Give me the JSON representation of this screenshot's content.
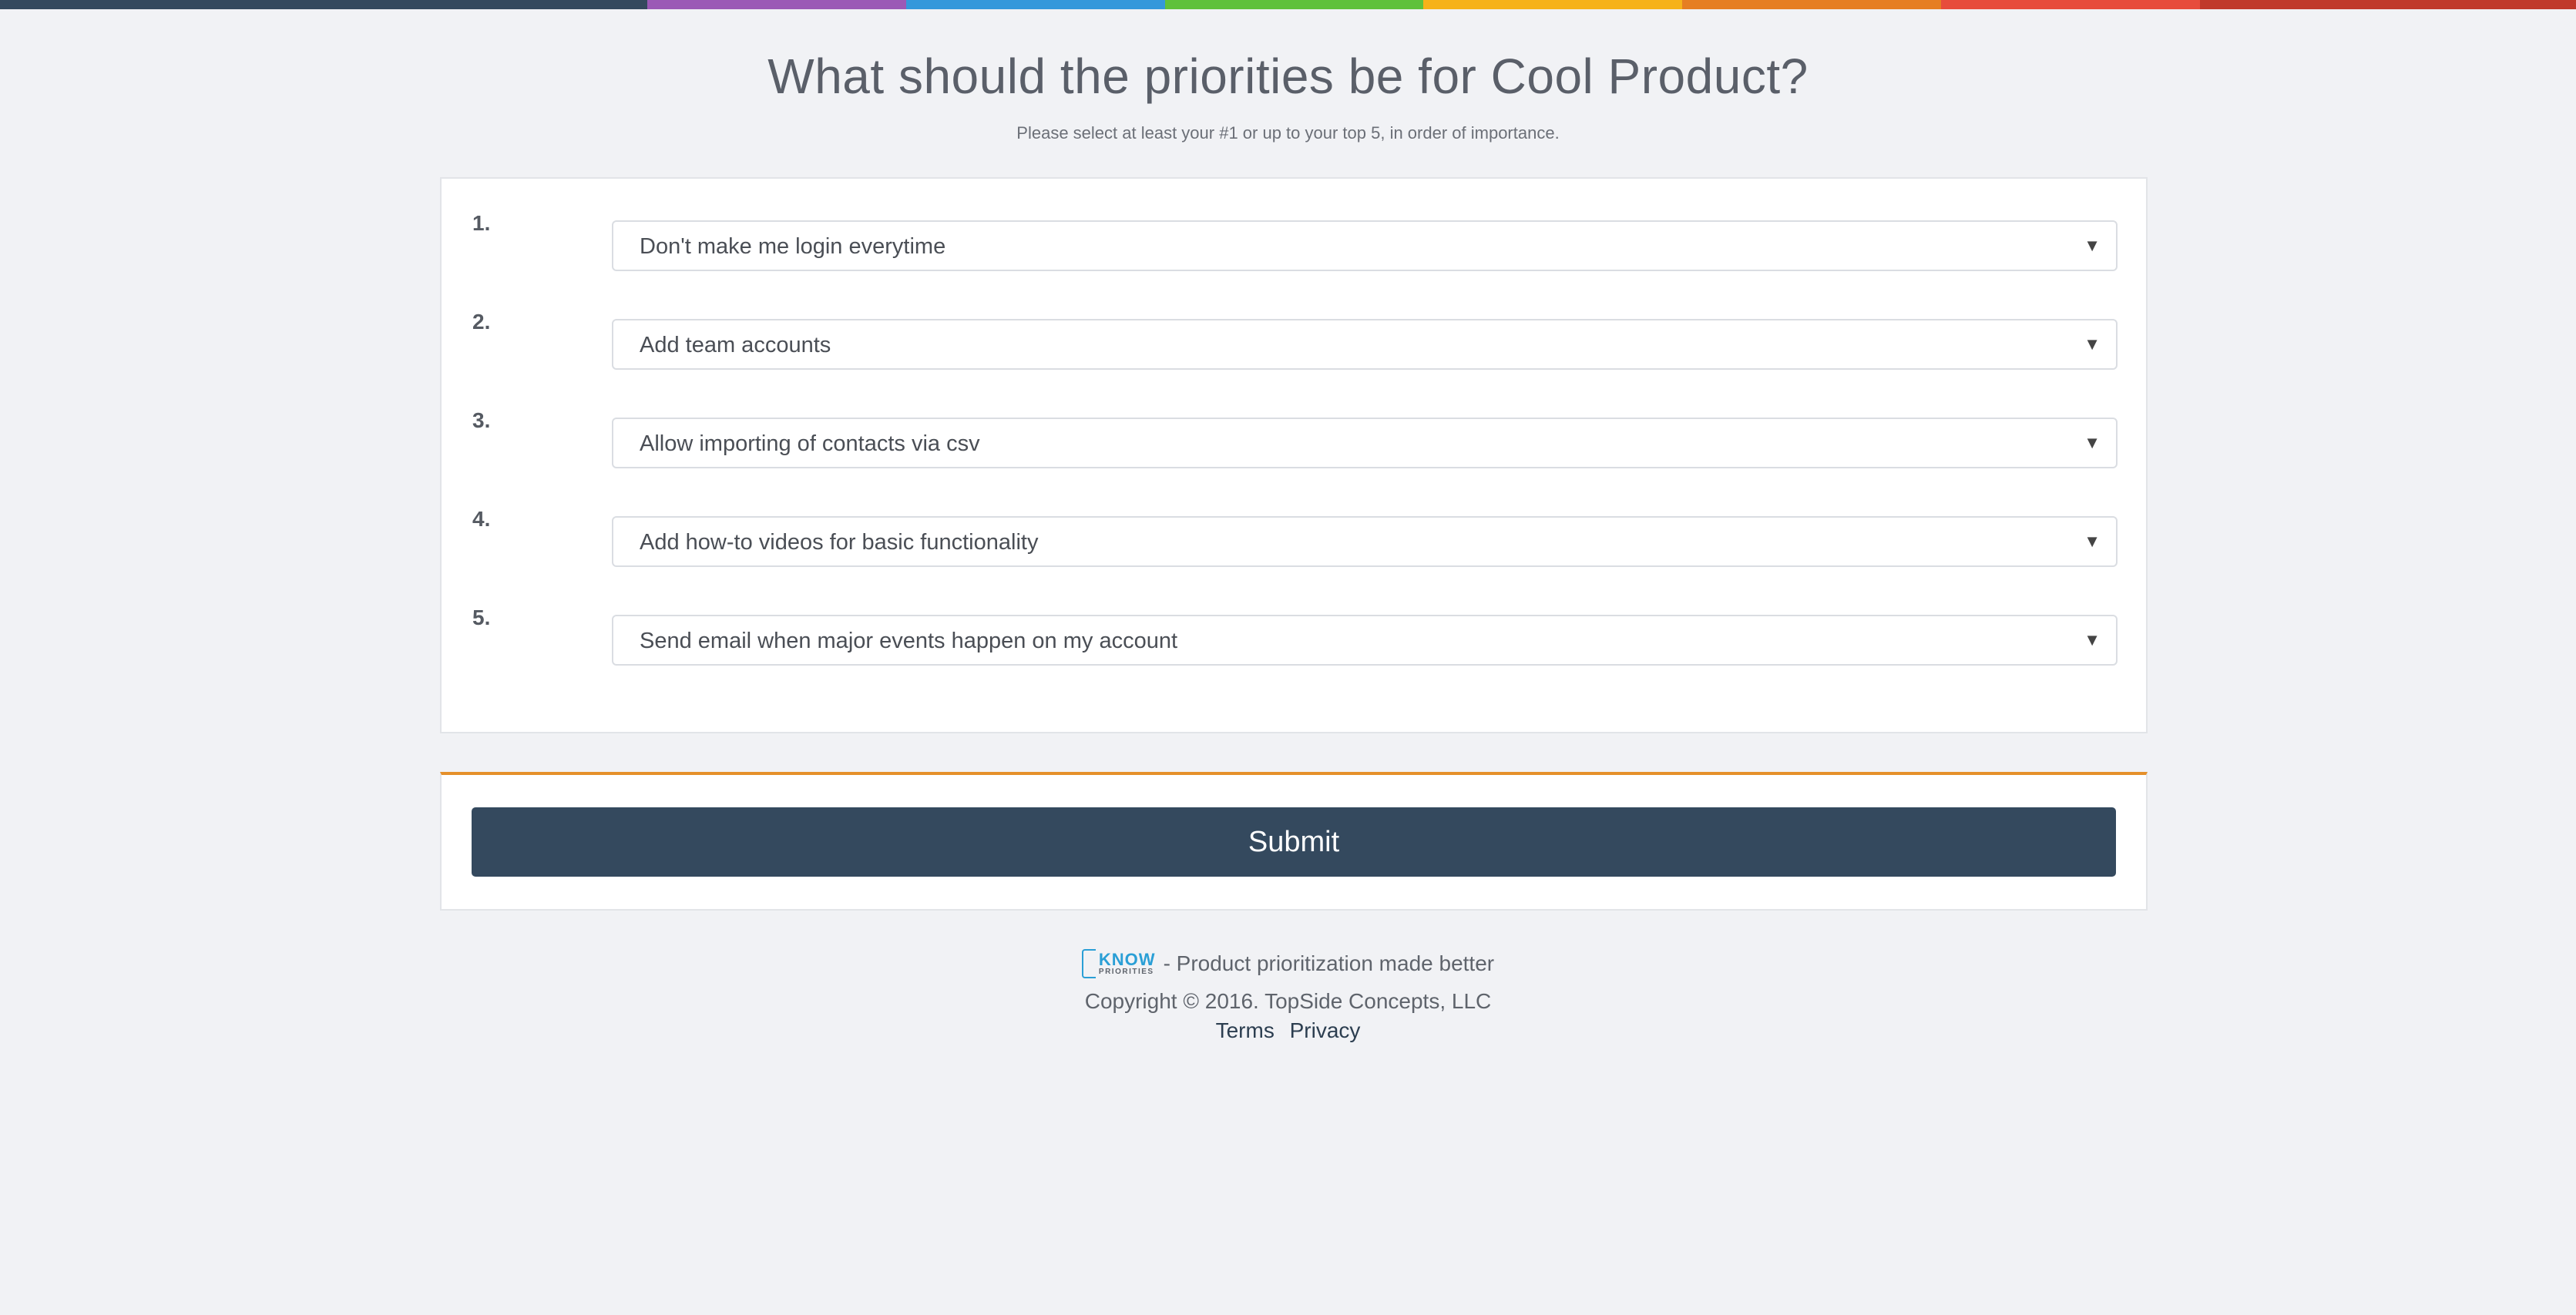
{
  "topbar_colors": [
    "#34495e",
    "#9b59b6",
    "#3498db",
    "#5fc13b",
    "#f6b21a",
    "#e67e22",
    "#e74c3c",
    "#c0392b"
  ],
  "heading": "What should the priorities be for Cool Product?",
  "subheading": "Please select at least your #1 or up to your top 5, in order of importance.",
  "priorities": [
    {
      "number": "1.",
      "selected": "Don't make me login everytime"
    },
    {
      "number": "2.",
      "selected": "Add team accounts"
    },
    {
      "number": "3.",
      "selected": "Allow importing of contacts via csv"
    },
    {
      "number": "4.",
      "selected": "Add how-to videos for basic functionality"
    },
    {
      "number": "5.",
      "selected": "Send email when major events happen on my account"
    }
  ],
  "submit_label": "Submit",
  "footer": {
    "logo_word": "KNOW",
    "logo_subword": "PRIORITIES",
    "tagline": "- Product prioritization made better",
    "copyright": "Copyright © 2016. TopSide Concepts, LLC",
    "links": {
      "terms": "Terms",
      "privacy": "Privacy"
    }
  }
}
